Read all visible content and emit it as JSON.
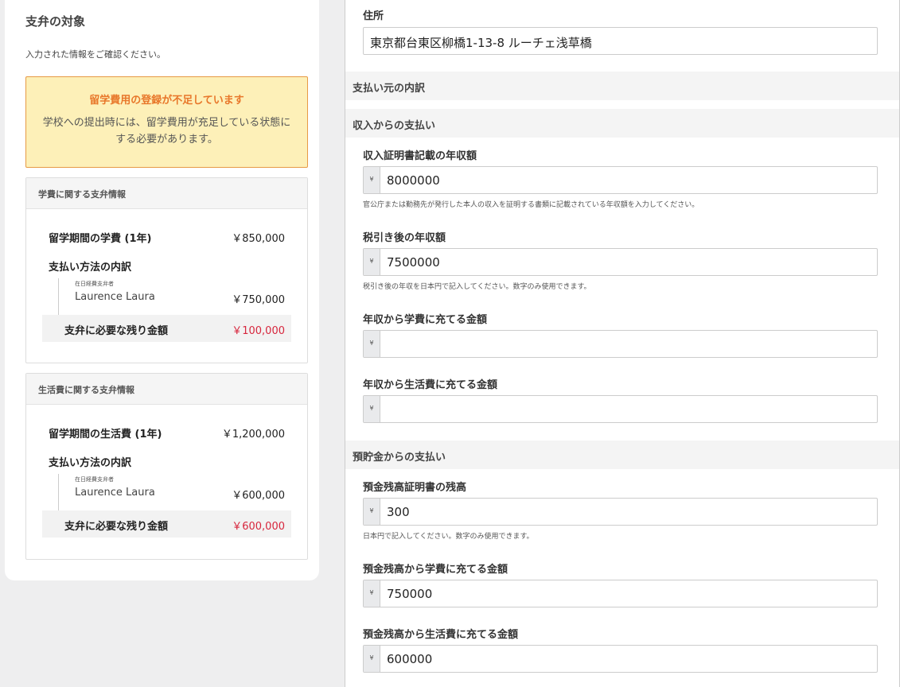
{
  "left": {
    "title": "支弁の対象",
    "subtitle": "入力された情報をご確認ください。",
    "warning": {
      "title": "留学費用の登録が不足しています",
      "body": "学校への提出時には、留学費用が充足している状態にする必要があります。"
    },
    "tuition": {
      "header": "学費に関する支弁情報",
      "period_label": "留学期間の学費 (1年)",
      "period_amount": "￥850,000",
      "breakdown_label": "支払い方法の内訳",
      "payer_role": "在日経費支弁者",
      "payer_name": "Laurence Laura",
      "payer_amount": "￥750,000",
      "remain_label": "支弁に必要な残り金額",
      "remain_amount": "￥100,000"
    },
    "living": {
      "header": "生活費に関する支弁情報",
      "period_label": "留学期間の生活費 (1年)",
      "period_amount": "￥1,200,000",
      "breakdown_label": "支払い方法の内訳",
      "payer_role": "在日経費支弁者",
      "payer_name": "Laurence Laura",
      "payer_amount": "￥600,000",
      "remain_label": "支弁に必要な残り金額",
      "remain_amount": "￥600,000"
    }
  },
  "right": {
    "address_label": "住所",
    "address_value": "東京都台東区柳橋1-13-8 ルーチェ浅草橋",
    "band_source": "支払い元の内訳",
    "band_income": "収入からの支払い",
    "currency": "¥",
    "income_cert_label": "収入証明書記載の年収額",
    "income_cert_value": "8000000",
    "income_cert_help": "官公庁または勤務先が発行した本人の収入を証明する書類に記載されている年収額を入力してください。",
    "after_tax_label": "税引き後の年収額",
    "after_tax_value": "7500000",
    "after_tax_help": "税引き後の年収を日本円で記入してください。数字のみ使用できます。",
    "income_tuition_label": "年収から学費に充てる金額",
    "income_tuition_value": "",
    "income_living_label": "年収から生活費に充てる金額",
    "income_living_value": "",
    "band_savings": "預貯金からの支払い",
    "balance_label": "預金残高証明書の残高",
    "balance_value": "300",
    "balance_help": "日本円で記入してください。数字のみ使用できます。",
    "savings_tuition_label": "預金残高から学費に充てる金額",
    "savings_tuition_value": "750000",
    "savings_living_label": "預金残高から生活費に充てる金額",
    "savings_living_value": "600000"
  }
}
